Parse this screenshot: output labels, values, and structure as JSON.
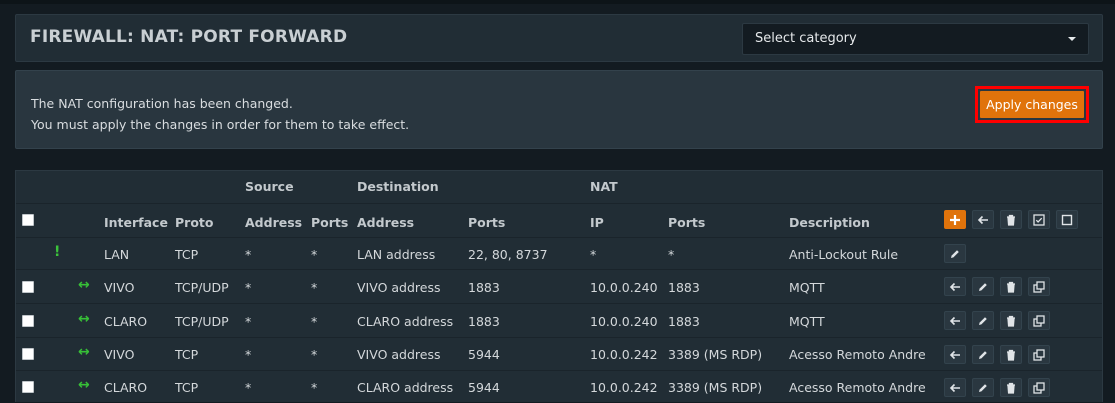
{
  "header": {
    "title": "FIREWALL: NAT: PORT FORWARD",
    "category_select": "Select category"
  },
  "notice": {
    "line1": "The NAT configuration has been changed.",
    "line2": "You must apply the changes in order for them to take effect.",
    "apply_label": "Apply changes"
  },
  "table": {
    "group_headers": {
      "source": "Source",
      "destination": "Destination",
      "nat": "NAT"
    },
    "columns": {
      "interface": "Interface",
      "proto": "Proto",
      "src_address": "Address",
      "src_ports": "Ports",
      "dst_address": "Address",
      "dst_ports": "Ports",
      "nat_ip": "IP",
      "nat_ports": "Ports",
      "description": "Description"
    },
    "rows": [
      {
        "interface": "LAN",
        "proto": "TCP",
        "src_address": "*",
        "src_ports": "*",
        "dst_address": "LAN address",
        "dst_ports": "22, 80, 8737",
        "nat_ip": "*",
        "nat_ports": "*",
        "description": "Anti-Lockout Rule"
      },
      {
        "interface": "VIVO",
        "proto": "TCP/UDP",
        "src_address": "*",
        "src_ports": "*",
        "dst_address": "VIVO address",
        "dst_ports": "1883",
        "nat_ip": "10.0.0.240",
        "nat_ports": "1883",
        "description": "MQTT"
      },
      {
        "interface": "CLARO",
        "proto": "TCP/UDP",
        "src_address": "*",
        "src_ports": "*",
        "dst_address": "CLARO address",
        "dst_ports": "1883",
        "nat_ip": "10.0.0.240",
        "nat_ports": "1883",
        "description": "MQTT"
      },
      {
        "interface": "VIVO",
        "proto": "TCP",
        "src_address": "*",
        "src_ports": "*",
        "dst_address": "VIVO address",
        "dst_ports": "5944",
        "nat_ip": "10.0.0.242",
        "nat_ports": "3389 (MS RDP)",
        "description": "Acesso Remoto Andre"
      },
      {
        "interface": "CLARO",
        "proto": "TCP",
        "src_address": "*",
        "src_ports": "*",
        "dst_address": "CLARO address",
        "dst_ports": "5944",
        "nat_ip": "10.0.0.242",
        "nat_ports": "3389 (MS RDP)",
        "description": "Acesso Remoto Andre"
      }
    ],
    "status_icons": {
      "anti_lockout": "!",
      "bidirectional": "↔"
    }
  },
  "colors": {
    "background": "#131b21",
    "panel": "#212d35",
    "accent": "#e0730b",
    "highlight_border": "#ff0000",
    "status_green": "#3bc33b"
  }
}
